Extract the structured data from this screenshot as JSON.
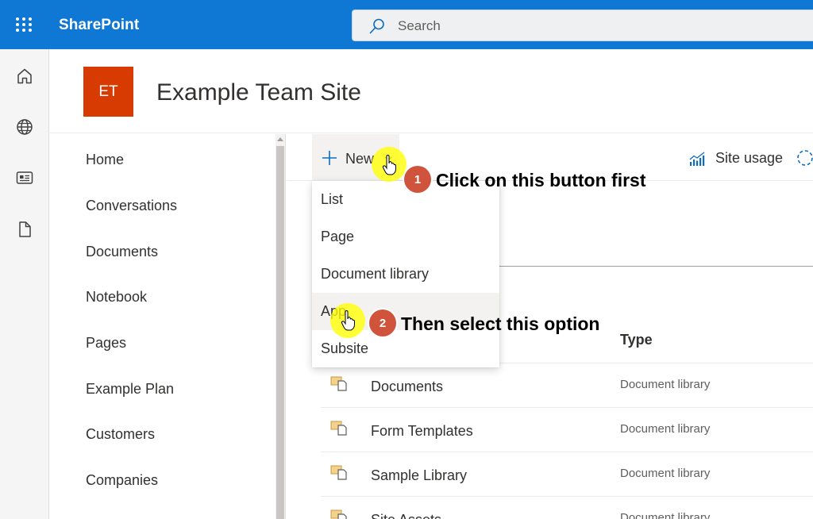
{
  "suite_bar": {
    "app_name": "SharePoint",
    "search_placeholder": "Search",
    "background": "#0f78d4"
  },
  "app_rail": {
    "icons": [
      "home-icon",
      "globe-icon",
      "news-icon",
      "document-icon"
    ]
  },
  "site": {
    "logo_initials": "ET",
    "logo_color": "#d83b01",
    "title": "Example Team Site"
  },
  "left_nav": {
    "items": [
      {
        "label": "Home"
      },
      {
        "label": "Conversations"
      },
      {
        "label": "Documents"
      },
      {
        "label": "Notebook"
      },
      {
        "label": "Pages"
      },
      {
        "label": "Example Plan"
      },
      {
        "label": "Customers"
      },
      {
        "label": "Companies"
      }
    ]
  },
  "command_bar": {
    "new_label": "New",
    "site_usage_label": "Site usage"
  },
  "new_menu": {
    "items": [
      {
        "label": "List"
      },
      {
        "label": "Page"
      },
      {
        "label": "Document library"
      },
      {
        "label": "App"
      },
      {
        "label": "Subsite"
      }
    ],
    "hovered": "App"
  },
  "contents": {
    "type_header": "Type",
    "rows": [
      {
        "name": "Documents",
        "type": "Document library"
      },
      {
        "name": "Form Templates",
        "type": "Document library"
      },
      {
        "name": "Sample Library",
        "type": "Document library"
      },
      {
        "name": "Site Assets",
        "type": "Document library"
      }
    ]
  },
  "annotations": {
    "step1": {
      "number": "1",
      "text": "Click on this button first"
    },
    "step2": {
      "number": "2",
      "text": "Then select this option"
    },
    "badge_color": "#d0533b",
    "highlight_color": "#ffff00"
  }
}
